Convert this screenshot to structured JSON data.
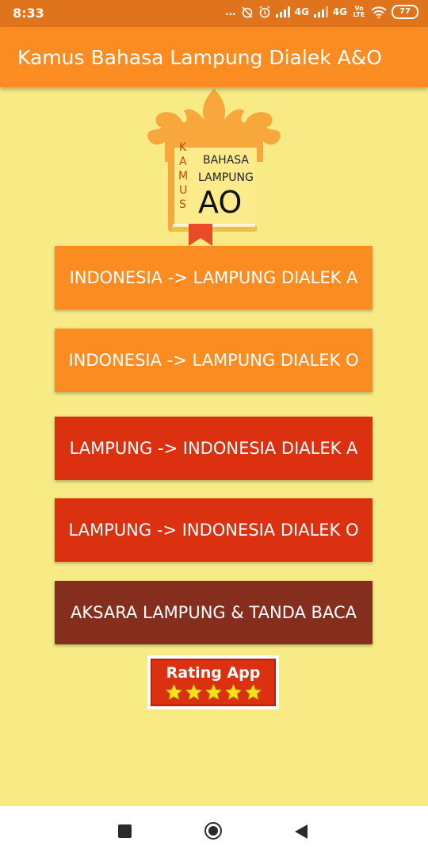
{
  "status_bar": {
    "time": "8:33",
    "dots": "...",
    "network1": "4G",
    "network2": "4G",
    "volte": "Vo LTE",
    "battery": "77"
  },
  "app_bar": {
    "title": "Kamus Bahasa Lampung Dialek A&O"
  },
  "logo": {
    "side_text": [
      "K",
      "A",
      "M",
      "U",
      "S"
    ],
    "line1": "BAHASA",
    "line2": "LAMPUNG",
    "big": "AO"
  },
  "menu": [
    {
      "label": "INDONESIA -> LAMPUNG DIALEK A",
      "color": "#FB8C22"
    },
    {
      "label": "INDONESIA -> LAMPUNG DIALEK O",
      "color": "#FB8C22"
    },
    {
      "label": "LAMPUNG -> INDONESIA DIALEK A",
      "color": "#DB3110"
    },
    {
      "label": "LAMPUNG -> INDONESIA DIALEK O",
      "color": "#DB3110"
    },
    {
      "label": "AKSARA LAMPUNG & TANDA BACA",
      "color": "#862E1E"
    }
  ],
  "rating": {
    "label": "Rating App",
    "stars": 5
  },
  "colors": {
    "background": "#F8EB86",
    "appbar": "#FB8C22",
    "statusbar": "#E0741C",
    "star": "#F5E21C"
  },
  "nav": {
    "icons": [
      "recents-square-icon",
      "home-circle-icon",
      "back-triangle-icon"
    ]
  }
}
